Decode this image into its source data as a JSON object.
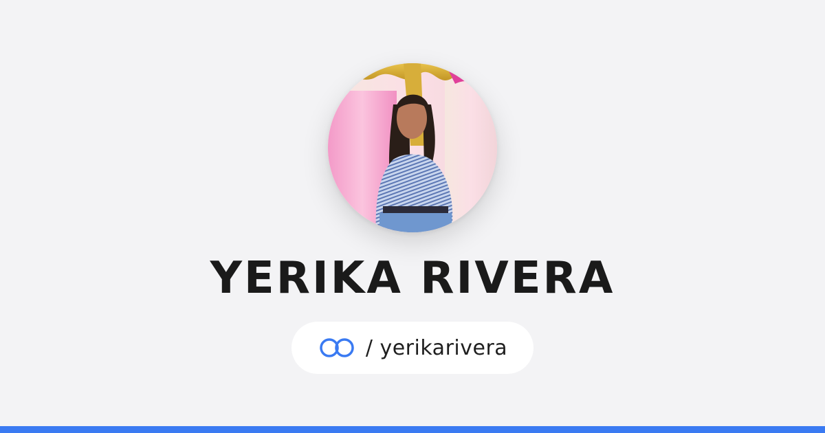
{
  "profile": {
    "name": "YERIKA RIVERA",
    "handle": "/ yerikarivera",
    "avatar_alt": "avatar"
  },
  "brand": {
    "logo_icon": "linked-rings-icon",
    "accent_color": "#3a7af2",
    "background_color": "#f3f3f5"
  }
}
